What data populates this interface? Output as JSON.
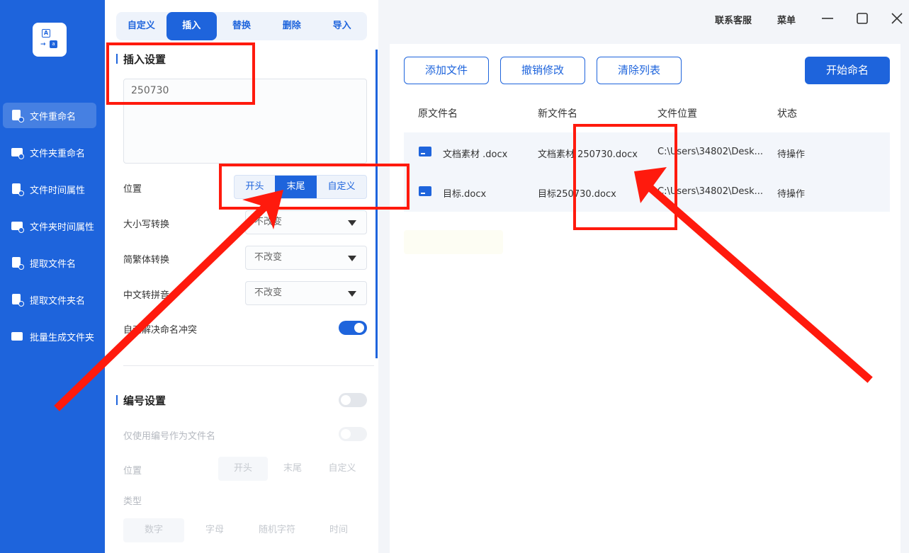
{
  "sidebar": {
    "items": [
      {
        "label": "文件重命名",
        "icon": "file-rename-icon"
      },
      {
        "label": "文件夹重命名",
        "icon": "folder-rename-icon"
      },
      {
        "label": "文件时间属性",
        "icon": "file-time-icon"
      },
      {
        "label": "文件夹时间属性",
        "icon": "folder-time-icon"
      },
      {
        "label": "提取文件名",
        "icon": "extract-filename-icon"
      },
      {
        "label": "提取文件夹名",
        "icon": "extract-foldername-icon"
      },
      {
        "label": "批量生成文件夹",
        "icon": "batch-folder-icon"
      }
    ]
  },
  "tabs": [
    "自定义",
    "插入",
    "替换",
    "删除",
    "导入"
  ],
  "insert": {
    "title": "插入设置",
    "text_value": "250730",
    "position_label": "位置",
    "position_options": [
      "开头",
      "末尾",
      "自定义"
    ],
    "case_label": "大小写转换",
    "case_value": "不改变",
    "trad_label": "简繁体转换",
    "trad_value": "不改变",
    "pinyin_label": "中文转拼音",
    "pinyin_value": "不改变",
    "conflict_label": "自动解决命名冲突",
    "conflict_on": true
  },
  "numbering": {
    "title": "编号设置",
    "only_number_label": "仅使用编号作为文件名",
    "position_label": "位置",
    "position_options": [
      "开头",
      "末尾",
      "自定义"
    ],
    "type_label": "类型",
    "type_options": [
      "数字",
      "字母",
      "随机字符",
      "时间"
    ]
  },
  "topbar": {
    "contact": "联系客服",
    "menu": "菜单"
  },
  "actions": {
    "add_file": "添加文件",
    "undo": "撤销修改",
    "clear": "清除列表",
    "start": "开始命名"
  },
  "table": {
    "headers": [
      "原文件名",
      "新文件名",
      "文件位置",
      "状态"
    ],
    "rows": [
      {
        "original": "文档素材 .docx",
        "new": "文档素材 250730.docx",
        "location": "C:\\Users\\34802\\Desk...",
        "status": "待操作"
      },
      {
        "original": "目标.docx",
        "new": "目标250730.docx",
        "location": "C:\\Users\\34802\\Desk...",
        "status": "待操作"
      }
    ]
  },
  "colors": {
    "accent": "#1e64dc",
    "annotation": "#ff1a0d"
  }
}
